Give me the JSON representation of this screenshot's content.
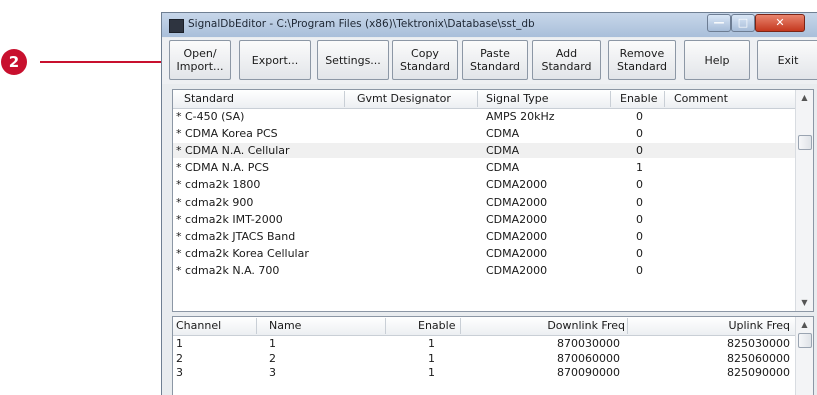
{
  "callout": {
    "number": "2",
    "color": "#c8102e"
  },
  "window": {
    "title": "SignalDbEditor - C:\\Program Files (x86)\\Tektronix\\Database\\sst_db",
    "min_glyph": "—",
    "max_glyph": "□",
    "close_glyph": "✕"
  },
  "toolbar": {
    "buttons": [
      {
        "line1": "Open/",
        "line2": "Import..."
      },
      {
        "line1": "Export...",
        "line2": ""
      },
      {
        "line1": "Settings...",
        "line2": ""
      },
      {
        "line1": "Copy",
        "line2": "Standard"
      },
      {
        "line1": "Paste",
        "line2": "Standard"
      },
      {
        "line1": "Add",
        "line2": "Standard"
      },
      {
        "line1": "Remove",
        "line2": "Standard"
      },
      {
        "line1": "Help",
        "line2": ""
      },
      {
        "line1": "Exit",
        "line2": ""
      }
    ]
  },
  "standards_table": {
    "headers": [
      "Standard",
      "Gvmt Designator",
      "Signal Type",
      "Enable",
      "Comment"
    ],
    "rows": [
      {
        "standard": "* C-450 (SA)",
        "designator": "",
        "signal_type": "AMPS 20kHz",
        "enable": "0",
        "comment": ""
      },
      {
        "standard": "* CDMA Korea PCS",
        "designator": "",
        "signal_type": "CDMA",
        "enable": "0",
        "comment": ""
      },
      {
        "standard": "* CDMA N.A. Cellular",
        "designator": "",
        "signal_type": "CDMA",
        "enable": "0",
        "comment": ""
      },
      {
        "standard": "* CDMA N.A. PCS",
        "designator": "",
        "signal_type": "CDMA",
        "enable": "1",
        "comment": ""
      },
      {
        "standard": "* cdma2k 1800",
        "designator": "",
        "signal_type": "CDMA2000",
        "enable": "0",
        "comment": ""
      },
      {
        "standard": "* cdma2k 900",
        "designator": "",
        "signal_type": "CDMA2000",
        "enable": "0",
        "comment": ""
      },
      {
        "standard": "* cdma2k IMT-2000",
        "designator": "",
        "signal_type": "CDMA2000",
        "enable": "0",
        "comment": ""
      },
      {
        "standard": "* cdma2k JTACS Band",
        "designator": "",
        "signal_type": "CDMA2000",
        "enable": "0",
        "comment": ""
      },
      {
        "standard": "* cdma2k Korea Cellular",
        "designator": "",
        "signal_type": "CDMA2000",
        "enable": "0",
        "comment": ""
      },
      {
        "standard": "* cdma2k N.A. 700",
        "designator": "",
        "signal_type": "CDMA2000",
        "enable": "0",
        "comment": ""
      }
    ],
    "selected_row": 2,
    "scroll_up": "▲",
    "scroll_down": "▼"
  },
  "channels_table": {
    "headers": [
      "Channel",
      "Name",
      "Enable",
      "Downlink Freq",
      "Uplink Freq"
    ],
    "rows": [
      {
        "channel": "1",
        "name": "1",
        "enable": "1",
        "downlink": "870030000",
        "uplink": "825030000"
      },
      {
        "channel": "2",
        "name": "2",
        "enable": "1",
        "downlink": "870060000",
        "uplink": "825060000"
      },
      {
        "channel": "3",
        "name": "3",
        "enable": "1",
        "downlink": "870090000",
        "uplink": "825090000"
      }
    ],
    "scroll_up": "▲"
  }
}
